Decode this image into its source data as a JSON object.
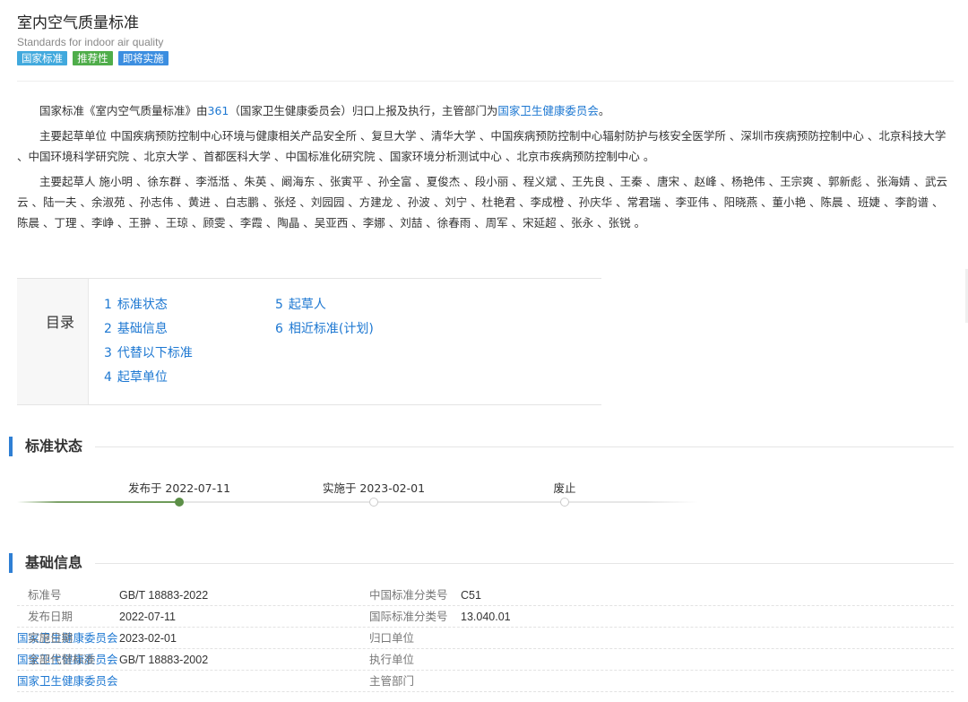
{
  "header": {
    "title": "室内空气质量标准",
    "subtitle": "Standards for indoor air quality",
    "tags": [
      "国家标准",
      "推荐性",
      "即将实施"
    ]
  },
  "intro": {
    "p1_prefix": "国家标准《室内空气质量标准》由",
    "p1_link1": "361",
    "p1_mid": "（国家卫生健康委员会）归口上报及执行，主管部门为",
    "p1_link2": "国家卫生健康委员会",
    "p1_suffix": "。",
    "p2": "主要起草单位 中国疾病预防控制中心环境与健康相关产品安全所 、复旦大学 、清华大学 、中国疾病预防控制中心辐射防护与核安全医学所 、深圳市疾病预防控制中心 、北京科技大学 、中国环境科学研究院 、北京大学 、首都医科大学 、中国标准化研究院 、国家环境分析测试中心 、北京市疾病预防控制中心 。",
    "p3": "主要起草人 施小明 、徐东群 、李湉湉 、朱英 、阚海东 、张寅平 、孙全富 、夏俊杰 、段小丽 、程义斌 、王先良 、王秦 、唐宋 、赵峰 、杨艳伟 、王宗爽 、郭新彪 、张海婧 、武云云 、陆一夫 、余淑苑 、孙志伟 、黄进 、白志鹏 、张烃 、刘园园 、方建龙 、孙波 、刘宁 、杜艳君 、李成橙 、孙庆华 、常君瑞 、李亚伟 、阳晓燕 、董小艳 、陈晨 、班婕 、李韵谱 、陈晨 、丁理 、李峥 、王翀 、王琼 、顾雯 、李霞 、陶晶 、吴亚西 、李娜 、刘喆 、徐春雨 、周军 、宋延超 、张永 、张锐 。"
  },
  "toc": {
    "label": "目录",
    "items": [
      {
        "num": "1",
        "label": "标准状态"
      },
      {
        "num": "2",
        "label": "基础信息"
      },
      {
        "num": "3",
        "label": "代替以下标准"
      },
      {
        "num": "4",
        "label": "起草单位"
      },
      {
        "num": "5",
        "label": "起草人"
      },
      {
        "num": "6",
        "label": "相近标准(计划)"
      }
    ]
  },
  "status": {
    "title": "标准状态",
    "steps": [
      {
        "label": "发布于 2022-07-11",
        "done": true
      },
      {
        "label": "实施于 2023-02-01",
        "done": false
      },
      {
        "label": "废止",
        "done": false
      }
    ]
  },
  "basic": {
    "title": "基础信息",
    "left": [
      {
        "key": "标准号",
        "value": "GB/T 18883-2022"
      },
      {
        "key": "发布日期",
        "value": "2022-07-11"
      },
      {
        "key": "实施日期",
        "value": "2023-02-01"
      },
      {
        "key": "全部代替标准",
        "value": "GB/T 18883-2002"
      }
    ],
    "right": [
      {
        "key": "中国标准分类号",
        "value": "C51"
      },
      {
        "key": "国际标准分类号",
        "value": "13.040.01"
      },
      {
        "key": "归口单位",
        "value": "国家卫生健康委员会"
      },
      {
        "key": "执行单位",
        "value": "国家卫生健康委员会"
      },
      {
        "key": "主管部门",
        "value": "国家卫生健康委员会"
      }
    ]
  },
  "colors": {
    "link": "#1e78d2",
    "accent_bar": "#2f7fd4",
    "tag_national": "#41a9dd",
    "tag_recommended": "#4fad4a",
    "tag_upcoming": "#3c8ee0",
    "timeline_done": "#5c8f47"
  }
}
